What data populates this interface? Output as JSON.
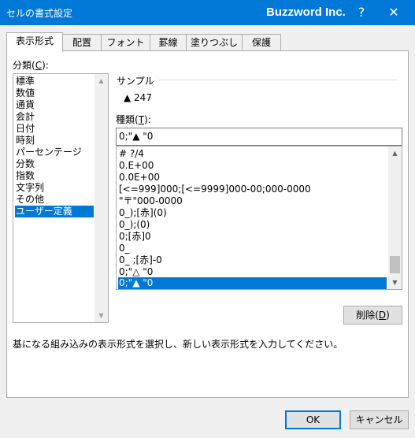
{
  "window": {
    "title": "セルの書式設定",
    "brand": "Buzzword Inc.",
    "help": "?",
    "close": "✕"
  },
  "tabs": [
    {
      "label": "表示形式",
      "active": true
    },
    {
      "label": "配置"
    },
    {
      "label": "フォント"
    },
    {
      "label": "罫線"
    },
    {
      "label": "塗りつぶし"
    },
    {
      "label": "保護"
    }
  ],
  "category": {
    "label_pre": "分類(",
    "label_key": "C",
    "label_post": "):",
    "items": [
      "標準",
      "数値",
      "通貨",
      "会計",
      "日付",
      "時刻",
      "パーセンテージ",
      "分数",
      "指数",
      "文字列",
      "その他",
      "ユーザー定義"
    ],
    "selected": "ユーザー定義"
  },
  "sample": {
    "label": "サンプル",
    "value": "▲ 247"
  },
  "type": {
    "label_pre": "種類(",
    "label_key": "T",
    "label_post": "):",
    "input_value": "0;\"▲ \"0",
    "items": [
      "# ?/4",
      "0.E+00",
      "0.0E+00",
      "[<=999]000;[<=9999]000-00;000-0000",
      "\"〒\"000-0000",
      "0_);[赤](0)",
      "0_);(0)",
      "0;[赤]0",
      "0_",
      "0_ ;[赤]-0",
      "0;\"△ \"0",
      "0;\"▲ \"0"
    ],
    "selected": "0;\"▲ \"0"
  },
  "delete_button": {
    "pre": "削除(",
    "key": "D",
    "post": ")"
  },
  "description": "基になる組み込みの表示形式を選択し、新しい表示形式を入力してください。",
  "ok_label": "OK",
  "cancel_label": "キャンセル",
  "colors": {
    "accent": "#0078d7",
    "titlebar_text": "#ffffff"
  }
}
